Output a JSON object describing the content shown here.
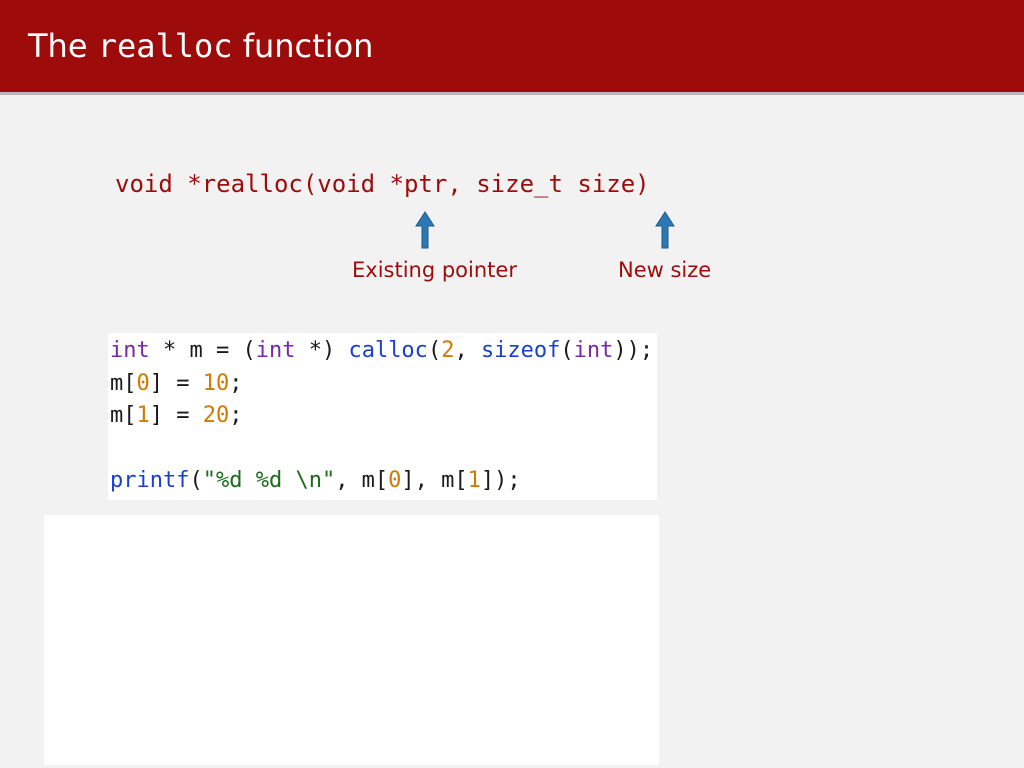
{
  "header": {
    "title_prefix": "The ",
    "title_mono": "realloc",
    "title_suffix": " function"
  },
  "signature": "void *realloc(void *ptr, size_t size)",
  "labels": {
    "ptr": "Existing pointer",
    "size": "New size"
  },
  "colors": {
    "header_bg": "#9e0b0b",
    "arrow_fill": "#2b78b5",
    "arrow_stroke": "#1a5a8a"
  },
  "code": {
    "line1": {
      "kw1": "int",
      "sp1": " * m = (",
      "kw2": "int",
      "sp2": " *) ",
      "fn1": "calloc",
      "p1": "(",
      "n1": "2",
      "p2": ", ",
      "fn2": "sizeof",
      "p3": "(",
      "kw3": "int",
      "p4": "));"
    },
    "line2": {
      "pre": "m[",
      "idx": "0",
      "mid": "] = ",
      "val": "10",
      "end": ";"
    },
    "line3": {
      "pre": "m[",
      "idx": "1",
      "mid": "] = ",
      "val": "20",
      "end": ";"
    },
    "line4": "",
    "line5": {
      "fn": "printf",
      "p1": "(",
      "str": "\"%d %d \\n\"",
      "p2": ", m[",
      "i1": "0",
      "p3": "], m[",
      "i2": "1",
      "p4": "]);"
    }
  }
}
